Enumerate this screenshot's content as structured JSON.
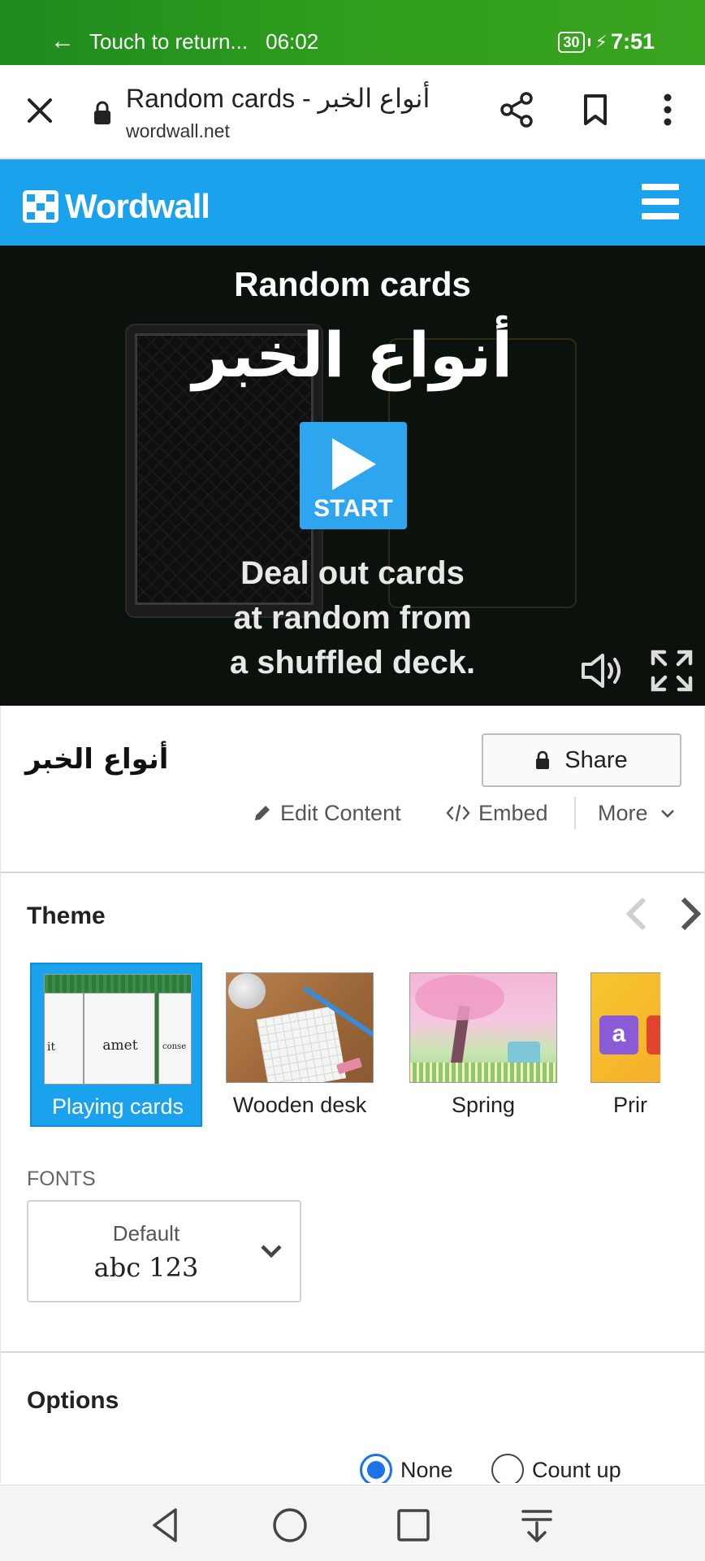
{
  "status_bar": {
    "return_text": "Touch to return...",
    "call_timer": "06:02",
    "battery": "30",
    "clock": "7:51"
  },
  "browser": {
    "page_title": "Random cards - أنواع الخبر",
    "host": "wordwall.net"
  },
  "header": {
    "logo_text": "Wordwall"
  },
  "game": {
    "title": "Random cards",
    "activity_name": "أنواع الخبر",
    "start_label": "START",
    "description_lines": [
      "Deal out cards",
      "at random from",
      "a shuffled deck."
    ]
  },
  "activity": {
    "title": "أنواع الخبر",
    "share_label": "Share",
    "edit_label": "Edit Content",
    "embed_label": "Embed",
    "more_label": "More"
  },
  "theme": {
    "heading": "Theme",
    "items": [
      {
        "label": "Playing cards",
        "selected": true,
        "card_words": [
          "it",
          "amet",
          "conse"
        ]
      },
      {
        "label": "Wooden desk",
        "selected": false
      },
      {
        "label": "Spring",
        "selected": false
      },
      {
        "label": "Prir",
        "selected": false,
        "tile_letter": "a"
      }
    ],
    "fonts_label": "FONTS",
    "font_name": "Default",
    "font_sample": "abc 123"
  },
  "options": {
    "heading": "Options",
    "radio_none": "None",
    "radio_count_up": "Count up",
    "selected": "None"
  },
  "colors": {
    "brand_blue": "#1aa2ec",
    "status_green": "#2f9e1c",
    "game_bg": "#0b120c"
  }
}
